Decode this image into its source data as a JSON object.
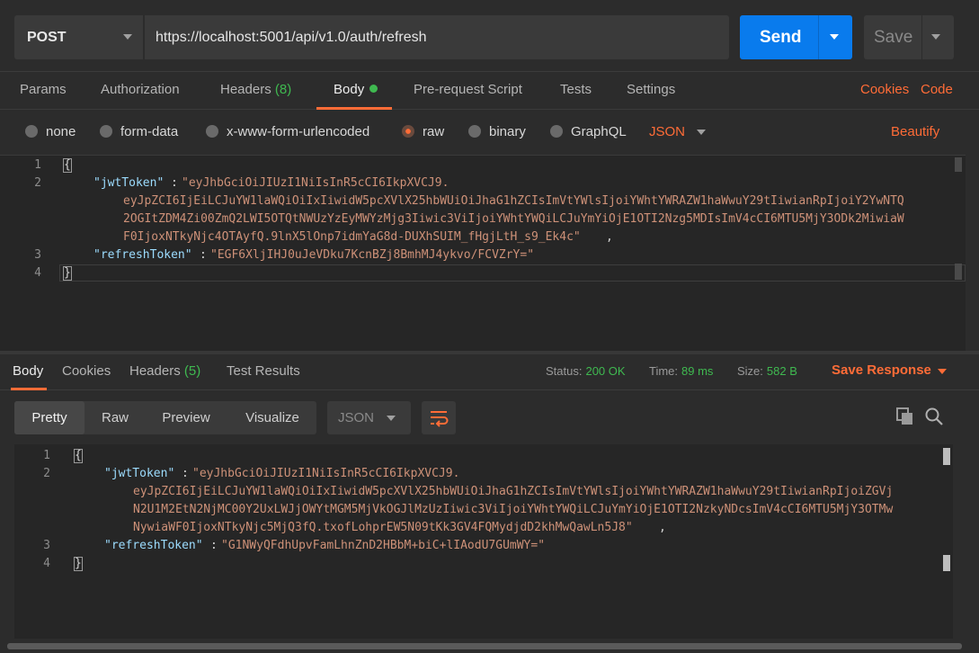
{
  "request": {
    "method": "POST",
    "url": "https://localhost:5001/api/v1.0/auth/refresh",
    "send_label": "Send",
    "save_label": "Save"
  },
  "request_tabs": {
    "params": "Params",
    "authorization": "Authorization",
    "headers": "Headers",
    "headers_count": "(8)",
    "body": "Body",
    "prerequest": "Pre-request Script",
    "tests": "Tests",
    "settings": "Settings",
    "cookies": "Cookies",
    "code": "Code"
  },
  "body_types": {
    "none": "none",
    "form_data": "form-data",
    "urlencoded": "x-www-form-urlencoded",
    "raw": "raw",
    "binary": "binary",
    "graphql": "GraphQL",
    "selected": "raw",
    "language": "JSON",
    "beautify": "Beautify"
  },
  "request_body": {
    "open": "{",
    "jwt_key": "\"jwtToken\"",
    "jwt_line1": "\"eyJhbGciOiJIUzI1NiIsInR5cCI6IkpXVCJ9.",
    "jwt_line2": "eyJpZCI6IjEiLCJuYW1laWQiOiIxIiwidW5pcXVlX25hbWUiOiJhaG1hZCIsImVtYWlsIjoiYWhtYWRAZW1haWwuY29tIiwianRpIjoiY2YwNTQ",
    "jwt_line3": "2OGItZDM4Zi00ZmQ2LWI5OTQtNWUzYzEyMWYzMjg3Iiwic3ViIjoiYWhtYWQiLCJuYmYiOjE1OTI2Nzg5MDIsImV4cCI6MTU5MjY3ODk2MiwiaW",
    "jwt_line4": "F0IjoxNTkyNjc4OTAyfQ.9lnX5lOnp7idmYaG8d-DUXhSUIM_fHgjLtH_s9_Ek4c\"",
    "refresh_key": "\"refreshToken\"",
    "refresh_value": "\"EGF6XljIHJ0uJeVDku7KcnBZj8BmhMJ4ykvo/FCVZrY=\"",
    "close": "}",
    "line_numbers": [
      "1",
      "2",
      "3",
      "4"
    ]
  },
  "response_tabs": {
    "body": "Body",
    "cookies": "Cookies",
    "headers": "Headers",
    "headers_count": "(5)",
    "test_results": "Test Results"
  },
  "response_meta": {
    "status_label": "Status:",
    "status": "200 OK",
    "time_label": "Time:",
    "time": "89 ms",
    "size_label": "Size:",
    "size": "582 B",
    "save_response": "Save Response"
  },
  "response_view": {
    "pretty": "Pretty",
    "raw": "Raw",
    "preview": "Preview",
    "visualize": "Visualize",
    "format": "JSON"
  },
  "response_body": {
    "open": "{",
    "jwt_key": "\"jwtToken\"",
    "jwt_line1": "\"eyJhbGciOiJIUzI1NiIsInR5cCI6IkpXVCJ9.",
    "jwt_line2": "eyJpZCI6IjEiLCJuYW1laWQiOiIxIiwidW5pcXVlX25hbWUiOiJhaG1hZCIsImVtYWlsIjoiYWhtYWRAZW1haWwuY29tIiwianRpIjoiZGVj",
    "jwt_line3": "N2U1M2EtN2NjMC00Y2UxLWJjOWYtMGM5MjVkOGJlMzUzIiwic3ViIjoiYWhtYWQiLCJuYmYiOjE1OTI2NzkyNDcsImV4cCI6MTU5MjY3OTMw",
    "jwt_line4": "NywiaWF0IjoxNTkyNjc5MjQ3fQ.txofLohprEW5N09tKk3GV4FQMydjdD2khMwQawLn5J8\"",
    "refresh_key": "\"refreshToken\"",
    "refresh_value": "\"G1NWyQFdhUpvFamLhnZnD2HBbM+biC+lIAodU7GUmWY=\"",
    "close": "}",
    "line_numbers": [
      "1",
      "2",
      "3",
      "4"
    ]
  },
  "colors": {
    "accent": "#ff6c37",
    "send": "#097bed",
    "success": "#3fb950"
  },
  "icons": [
    "chevron-down-icon",
    "wrap-lines-icon",
    "copy-icon",
    "search-icon"
  ]
}
